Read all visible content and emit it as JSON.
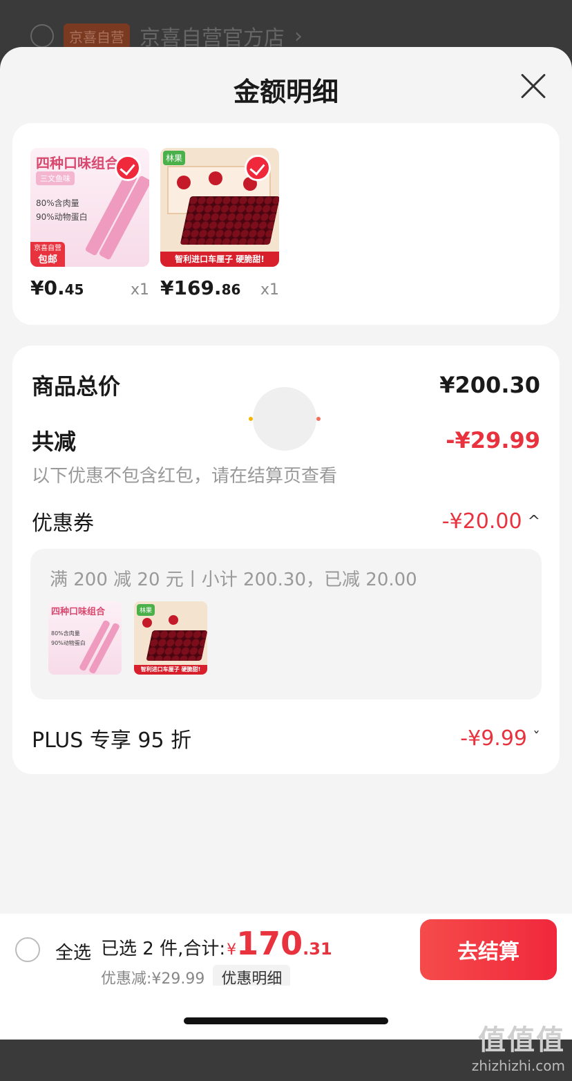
{
  "background": {
    "badge": "京喜自营",
    "store_name": "京喜自营官方店",
    "chevron": "›"
  },
  "sheet": {
    "title": "金额明细"
  },
  "products": [
    {
      "thumb_title": "四种口味组合",
      "thumb_tag": "三文鱼味",
      "thumb_line1": "80%含肉量",
      "thumb_line2": "90%动物蛋白",
      "thumb_badge_top": "京喜自营",
      "thumb_badge_bottom": "包邮",
      "price_int": "¥0.",
      "price_dec": "45",
      "qty": "x1"
    },
    {
      "thumb_logo": "林果",
      "thumb_banner": "智利进口车厘子 硬脆甜!",
      "price_int": "¥169.",
      "price_dec": "86",
      "qty": "x1"
    }
  ],
  "summary": {
    "total_label": "商品总价",
    "total_value": "¥200.30",
    "reduce_label": "共减",
    "reduce_value": "-¥29.99",
    "note": "以下优惠不包含红包，请在结算页查看",
    "coupon_label": "优惠券",
    "coupon_value": "-¥20.00",
    "coupon_chevron": "^",
    "coupon_detail": "满 200 减 20 元丨小计 200.30，已减 20.00",
    "plus_label": "PLUS 专享 95 折",
    "plus_value": "-¥9.99",
    "plus_chevron": "ˇ"
  },
  "bottom": {
    "select_all": "全选",
    "selected_text": "已选 2 件,合计:",
    "currency": "¥",
    "total_int": "170",
    "total_dec": ".31",
    "discount_text": "优惠减:¥29.99",
    "discount_detail_btn": "优惠明细",
    "checkout": "去结算"
  },
  "watermark": {
    "line1": "值值值",
    "line2": "zhizhizhi.com"
  },
  "colors": {
    "accent_red": "#e8323e",
    "checkout_red": "#f0283c",
    "sheet_bg": "#f4f4f4"
  }
}
